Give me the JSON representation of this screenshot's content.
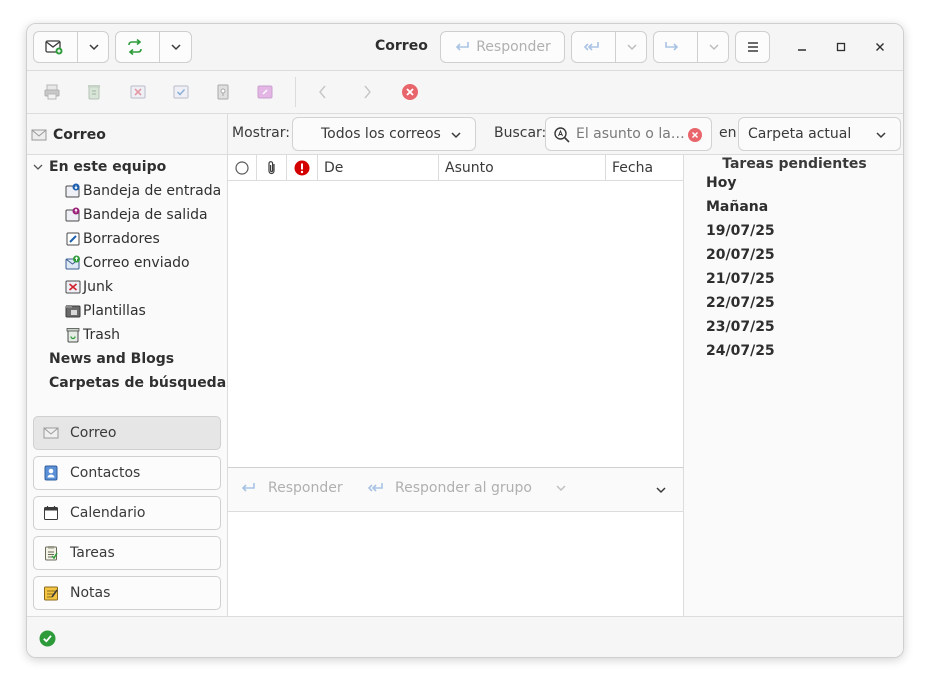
{
  "header": {
    "title": "Correo",
    "reply_label": "Responder",
    "menu_icon": "hamburger-icon",
    "minimize_icon": "minimize-icon",
    "maximize_icon": "maximize-icon",
    "close_icon": "close-icon"
  },
  "filter": {
    "sidebar_title": "Correo",
    "show_label": "Mostrar:",
    "show_value": "Todos los correos",
    "search_label": "Buscar:",
    "search_placeholder": "El asunto o la…",
    "in_label": "en",
    "scope_value": "Carpeta actual"
  },
  "sidebar": {
    "root": "En este equipo",
    "folders": [
      {
        "label": "Bandeja de entrada",
        "icon": "inbox-icon"
      },
      {
        "label": "Bandeja de salida",
        "icon": "outbox-icon"
      },
      {
        "label": "Borradores",
        "icon": "drafts-icon"
      },
      {
        "label": "Correo enviado",
        "icon": "sent-icon"
      },
      {
        "label": "Junk",
        "icon": "junk-icon"
      },
      {
        "label": "Plantillas",
        "icon": "templates-icon"
      },
      {
        "label": "Trash",
        "icon": "trash-icon"
      }
    ],
    "extra": [
      "News and Blogs",
      "Carpetas de búsqueda"
    ]
  },
  "switcher": [
    {
      "label": "Correo",
      "icon": "mail-icon"
    },
    {
      "label": "Contactos",
      "icon": "contacts-icon"
    },
    {
      "label": "Calendario",
      "icon": "calendar-icon"
    },
    {
      "label": "Tareas",
      "icon": "tasks-icon"
    },
    {
      "label": "Notas",
      "icon": "notes-icon"
    }
  ],
  "columns": {
    "from": "De",
    "subject": "Asunto",
    "date": "Fecha"
  },
  "preview": {
    "reply": "Responder",
    "reply_group": "Responder al grupo"
  },
  "tasks": {
    "title": "Tareas pendientes",
    "items": [
      "Hoy",
      "Mañana",
      "19/07/25",
      "20/07/25",
      "21/07/25",
      "22/07/25",
      "23/07/25",
      "24/07/25"
    ]
  },
  "colors": {
    "accent_green": "#2e9b3a",
    "accent_blue": "#3584e4",
    "error_red": "#e01b24"
  }
}
